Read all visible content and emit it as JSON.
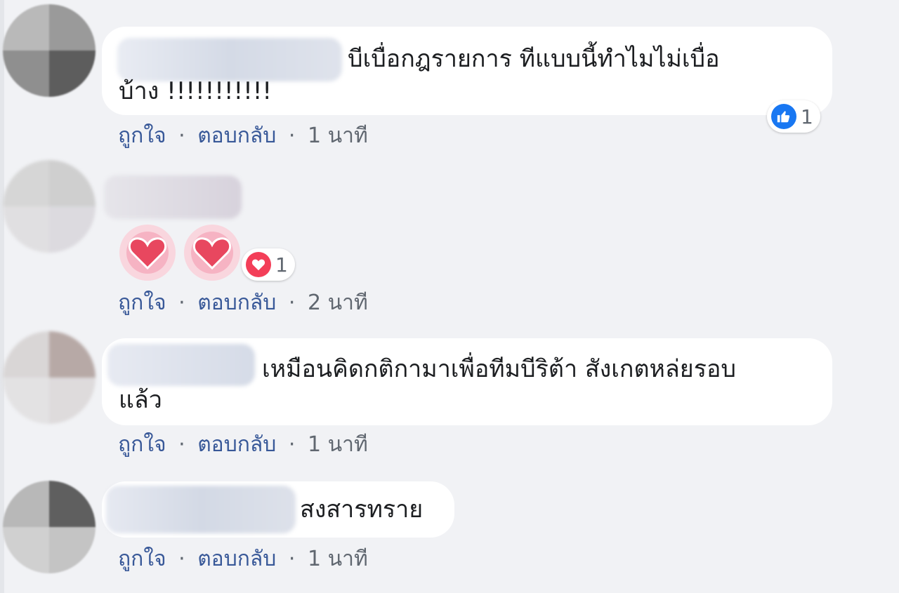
{
  "colors": {
    "background": "#f1f2f5",
    "bubble": "#ffffff",
    "link": "#385898",
    "meta": "#606770",
    "like": "#1877f2",
    "love": "#f33e58"
  },
  "comments": [
    {
      "text_line1": "บีเบื่อกฎรายการ ทีแบบนี้ทำไมไม่เบื่อ",
      "text_line2": "บ้าง !!!!!!!!!!!",
      "like_label": "ถูกใจ",
      "sep1": "·",
      "reply_label": "ตอบกลับ",
      "sep2": "·",
      "time": "1 นาที",
      "reaction": {
        "icon": "like-icon",
        "count": "1"
      }
    },
    {
      "content_icons": [
        "heart-icon",
        "heart-icon"
      ],
      "like_label": "ถูกใจ",
      "sep1": "·",
      "reply_label": "ตอบกลับ",
      "sep2": "·",
      "time": "2 นาที",
      "reaction": {
        "icon": "love-icon",
        "count": "1"
      }
    },
    {
      "text_line1": "เหมือนคิดกติกามาเพื่อทีมบีริต้า สังเกตหล่ยรอบ",
      "text_line2": "แล้ว",
      "like_label": "ถูกใจ",
      "sep1": "·",
      "reply_label": "ตอบกลับ",
      "sep2": "·",
      "time": "1 นาที"
    },
    {
      "text_line1": "สงสารทราย",
      "like_label": "ถูกใจ",
      "sep1": "·",
      "reply_label": "ตอบกลับ",
      "sep2": "·",
      "time": "1 นาที"
    }
  ]
}
